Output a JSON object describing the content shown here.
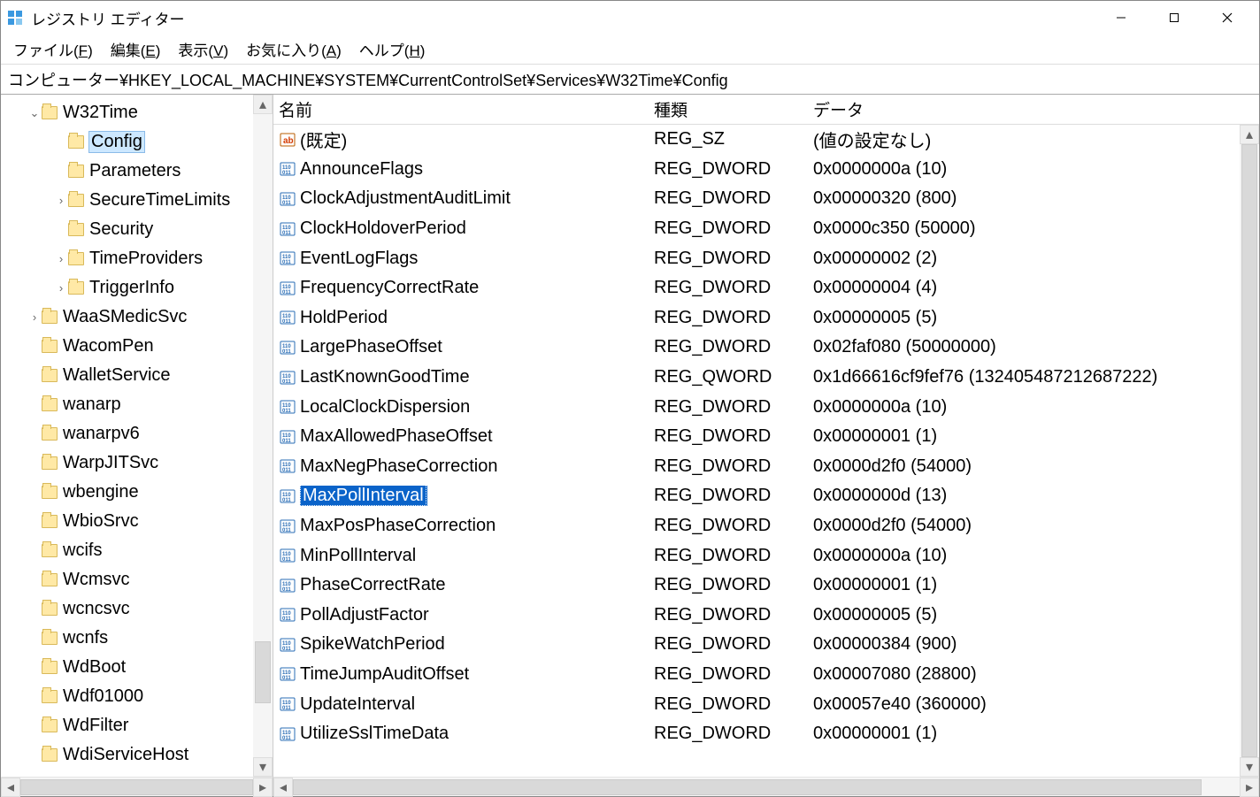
{
  "titlebar": {
    "title": "レジストリ エディター"
  },
  "menus": [
    {
      "label": "ファイル",
      "key": "F"
    },
    {
      "label": "編集",
      "key": "E"
    },
    {
      "label": "表示",
      "key": "V"
    },
    {
      "label": "お気に入り",
      "key": "A"
    },
    {
      "label": "ヘルプ",
      "key": "H"
    }
  ],
  "address": "コンピューター¥HKEY_LOCAL_MACHINE¥SYSTEM¥CurrentControlSet¥Services¥W32Time¥Config",
  "tree": [
    {
      "indent": 1,
      "expander": "v",
      "label": "W32Time",
      "selected": false
    },
    {
      "indent": 2,
      "expander": " ",
      "label": "Config",
      "selected": true
    },
    {
      "indent": 2,
      "expander": " ",
      "label": "Parameters"
    },
    {
      "indent": 2,
      "expander": ">",
      "label": "SecureTimeLimits"
    },
    {
      "indent": 2,
      "expander": " ",
      "label": "Security"
    },
    {
      "indent": 2,
      "expander": ">",
      "label": "TimeProviders"
    },
    {
      "indent": 2,
      "expander": ">",
      "label": "TriggerInfo"
    },
    {
      "indent": 1,
      "expander": ">",
      "label": "WaaSMedicSvc"
    },
    {
      "indent": 1,
      "expander": " ",
      "label": "WacomPen"
    },
    {
      "indent": 1,
      "expander": " ",
      "label": "WalletService"
    },
    {
      "indent": 1,
      "expander": " ",
      "label": "wanarp"
    },
    {
      "indent": 1,
      "expander": " ",
      "label": "wanarpv6"
    },
    {
      "indent": 1,
      "expander": " ",
      "label": "WarpJITSvc"
    },
    {
      "indent": 1,
      "expander": " ",
      "label": "wbengine"
    },
    {
      "indent": 1,
      "expander": " ",
      "label": "WbioSrvc"
    },
    {
      "indent": 1,
      "expander": " ",
      "label": "wcifs"
    },
    {
      "indent": 1,
      "expander": " ",
      "label": "Wcmsvc"
    },
    {
      "indent": 1,
      "expander": " ",
      "label": "wcncsvc"
    },
    {
      "indent": 1,
      "expander": " ",
      "label": "wcnfs"
    },
    {
      "indent": 1,
      "expander": " ",
      "label": "WdBoot"
    },
    {
      "indent": 1,
      "expander": " ",
      "label": "Wdf01000"
    },
    {
      "indent": 1,
      "expander": " ",
      "label": "WdFilter"
    },
    {
      "indent": 1,
      "expander": " ",
      "label": "WdiServiceHost"
    }
  ],
  "columns": {
    "name": "名前",
    "type": "種類",
    "data": "データ"
  },
  "values": [
    {
      "icon": "str",
      "name": "(既定)",
      "type": "REG_SZ",
      "data": "(値の設定なし)"
    },
    {
      "icon": "bin",
      "name": "AnnounceFlags",
      "type": "REG_DWORD",
      "data": "0x0000000a (10)"
    },
    {
      "icon": "bin",
      "name": "ClockAdjustmentAuditLimit",
      "type": "REG_DWORD",
      "data": "0x00000320 (800)"
    },
    {
      "icon": "bin",
      "name": "ClockHoldoverPeriod",
      "type": "REG_DWORD",
      "data": "0x0000c350 (50000)"
    },
    {
      "icon": "bin",
      "name": "EventLogFlags",
      "type": "REG_DWORD",
      "data": "0x00000002 (2)"
    },
    {
      "icon": "bin",
      "name": "FrequencyCorrectRate",
      "type": "REG_DWORD",
      "data": "0x00000004 (4)"
    },
    {
      "icon": "bin",
      "name": "HoldPeriod",
      "type": "REG_DWORD",
      "data": "0x00000005 (5)"
    },
    {
      "icon": "bin",
      "name": "LargePhaseOffset",
      "type": "REG_DWORD",
      "data": "0x02faf080 (50000000)"
    },
    {
      "icon": "bin",
      "name": "LastKnownGoodTime",
      "type": "REG_QWORD",
      "data": "0x1d66616cf9fef76 (132405487212687222)"
    },
    {
      "icon": "bin",
      "name": "LocalClockDispersion",
      "type": "REG_DWORD",
      "data": "0x0000000a (10)"
    },
    {
      "icon": "bin",
      "name": "MaxAllowedPhaseOffset",
      "type": "REG_DWORD",
      "data": "0x00000001 (1)"
    },
    {
      "icon": "bin",
      "name": "MaxNegPhaseCorrection",
      "type": "REG_DWORD",
      "data": "0x0000d2f0 (54000)"
    },
    {
      "icon": "bin",
      "name": "MaxPollInterval",
      "type": "REG_DWORD",
      "data": "0x0000000d (13)",
      "selected": true
    },
    {
      "icon": "bin",
      "name": "MaxPosPhaseCorrection",
      "type": "REG_DWORD",
      "data": "0x0000d2f0 (54000)"
    },
    {
      "icon": "bin",
      "name": "MinPollInterval",
      "type": "REG_DWORD",
      "data": "0x0000000a (10)"
    },
    {
      "icon": "bin",
      "name": "PhaseCorrectRate",
      "type": "REG_DWORD",
      "data": "0x00000001 (1)"
    },
    {
      "icon": "bin",
      "name": "PollAdjustFactor",
      "type": "REG_DWORD",
      "data": "0x00000005 (5)"
    },
    {
      "icon": "bin",
      "name": "SpikeWatchPeriod",
      "type": "REG_DWORD",
      "data": "0x00000384 (900)"
    },
    {
      "icon": "bin",
      "name": "TimeJumpAuditOffset",
      "type": "REG_DWORD",
      "data": "0x00007080 (28800)"
    },
    {
      "icon": "bin",
      "name": "UpdateInterval",
      "type": "REG_DWORD",
      "data": "0x00057e40 (360000)"
    },
    {
      "icon": "bin",
      "name": "UtilizeSslTimeData",
      "type": "REG_DWORD",
      "data": "0x00000001 (1)"
    }
  ]
}
